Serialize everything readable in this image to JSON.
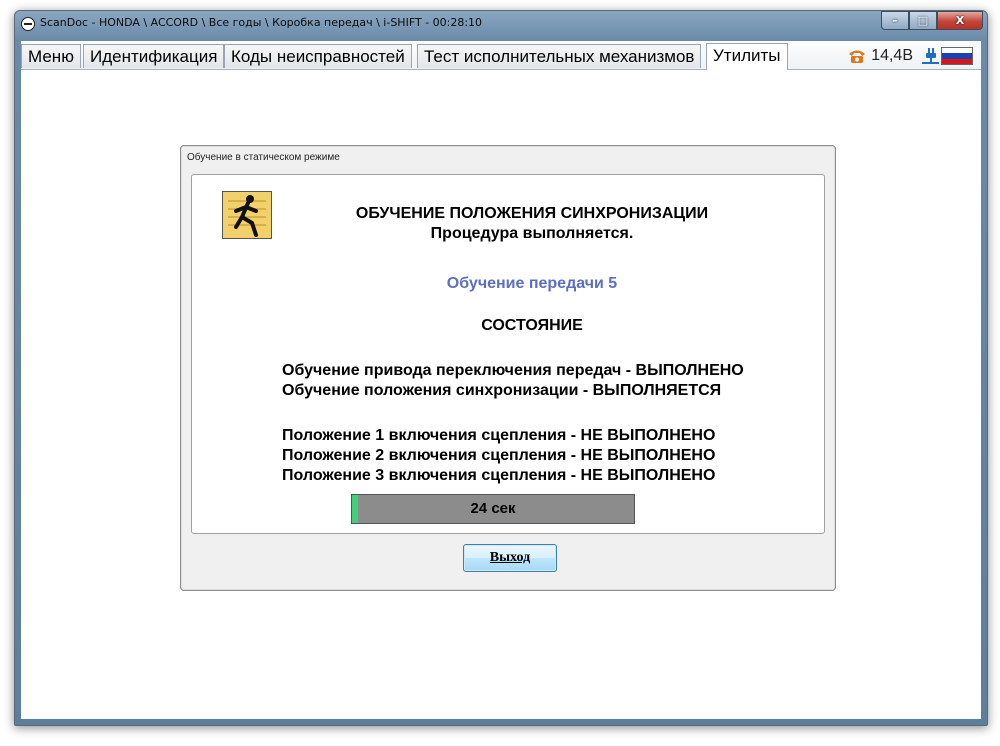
{
  "window": {
    "title": "ScanDoc - HONDA \\ ACCORD \\ Все годы \\ Коробка передач \\ i-SHIFT - 00:28:10",
    "buttons": {
      "minimize": "–",
      "maximize": "□",
      "close": "X"
    }
  },
  "tabs": [
    {
      "label": "Меню",
      "active": false
    },
    {
      "label": "Идентификация",
      "active": false
    },
    {
      "label": "Коды неисправностей",
      "active": false
    },
    {
      "label": "Тест исполнительных механизмов",
      "active": false
    },
    {
      "label": "Утилиты",
      "active": true
    }
  ],
  "status": {
    "voltage": "14,4В",
    "icons": [
      "phone-icon",
      "plug-icon",
      "russian-flag-icon"
    ],
    "colors": {
      "phone": "#e0771d",
      "plug": "#1e6fc2"
    }
  },
  "dialog": {
    "title": "Обучение в статическом режиме",
    "heading": "ОБУЧЕНИЕ ПОЛОЖЕНИЯ СИНХРОНИЗАЦИИ",
    "subheading": "Процедура выполняется.",
    "gear_learning": "Обучение передачи 5",
    "gear_learning_color": "#5b6fc4",
    "state_title": "СОСТОЯНИЕ",
    "lines": [
      "Обучение привода переключения передач - ВЫПОЛНЕНО",
      "Обучение положения синхронизации - ВЫПОЛНЯЕТСЯ"
    ],
    "clutch_lines": [
      "Положение 1 включения сцепления - НЕ ВЫПОЛНЕНО",
      "Положение 2 включения сцепления - НЕ ВЫПОЛНЕНО",
      "Положение 3 включения сцепления - НЕ ВЫПОЛНЕНО"
    ],
    "progress": {
      "label": "24 сек",
      "fraction": 0.02
    },
    "exit_button": "Выход"
  }
}
